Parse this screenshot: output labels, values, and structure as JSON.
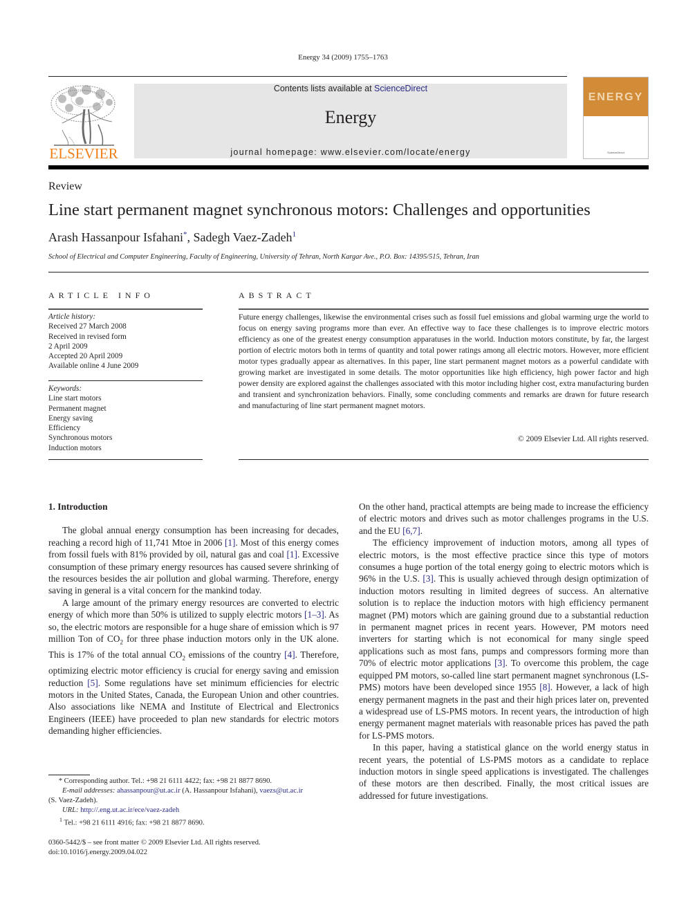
{
  "running_head": "Energy 34 (2009) 1755–1763",
  "masthead": {
    "publisher_logo_text": "ELSEVIER",
    "contents_prefix": "Contents lists available at ",
    "contents_link": "ScienceDirect",
    "journal_name": "Energy",
    "homepage_label": "journal homepage: www.elsevier.com/locate/energy",
    "cover_word": "ENERGY",
    "cover_footer": "ScienceDirect",
    "colors": {
      "elsevier_orange": "#f07f1a",
      "banner_gray": "#e6e6e6",
      "cover_orange": "#d28b36",
      "link_blue": "#2a2a86"
    }
  },
  "article": {
    "type": "Review",
    "title": "Line start permanent magnet synchronous motors: Challenges and opportunities",
    "authors": [
      {
        "name": "Arash Hassanpour Isfahani",
        "mark": "*"
      },
      {
        "name": "Sadegh Vaez-Zadeh",
        "mark": "1"
      }
    ],
    "author_separator": ", ",
    "affiliation": "School of Electrical and Computer Engineering, Faculty of Engineering, University of Tehran, North Kargar Ave., P.O. Box: 14395/515, Tehran, Iran"
  },
  "article_info": {
    "heading": "ARTICLE INFO",
    "history_label": "Article history:",
    "history": [
      "Received 27 March 2008",
      "Received in revised form",
      "2 April 2009",
      "Accepted 20 April 2009",
      "Available online 4 June 2009"
    ],
    "keywords_label": "Keywords:",
    "keywords": [
      "Line start motors",
      "Permanent magnet",
      "Energy saving",
      "Efficiency",
      "Synchronous motors",
      "Induction motors"
    ]
  },
  "abstract": {
    "heading": "ABSTRACT",
    "text": "Future energy challenges, likewise the environmental crises such as fossil fuel emissions and global warming urge the world to focus on energy saving programs more than ever. An effective way to face these challenges is to improve electric motors efficiency as one of the greatest energy consumption apparatuses in the world. Induction motors constitute, by far, the largest portion of electric motors both in terms of quantity and total power ratings among all electric motors. However, more efficient motor types gradually appear as alternatives. In this paper, line start permanent magnet motors as a powerful candidate with growing market are investigated in some details. The motor opportunities like high efficiency, high power factor and high power density are explored against the challenges associated with this motor including higher cost, extra manufacturing burden and transient and synchronization behaviors. Finally, some concluding comments and remarks are drawn for future research and manufacturing of line start permanent magnet motors.",
    "copyright": "© 2009 Elsevier Ltd. All rights reserved."
  },
  "body": {
    "section_heading": "1.  Introduction",
    "left_paragraphs": [
      [
        {
          "t": "The global annual energy consumption has been increasing for decades, reaching a record high of 11,741 Mtoe in 2006 "
        },
        {
          "ref": "[1]"
        },
        {
          "t": ". Most of this energy comes from fossil fuels with 81% provided by oil, natural gas and coal "
        },
        {
          "ref": "[1]"
        },
        {
          "t": ". Excessive consumption of these primary energy resources has caused severe shrinking of the resources besides the air pollution and global warming. Therefore, energy saving in general is a vital concern for the mankind today."
        }
      ],
      [
        {
          "t": "A large amount of the primary energy resources are converted to electric energy of which more than 50% is utilized to supply electric motors "
        },
        {
          "ref": "[1–3]"
        },
        {
          "t": ". As so, the electric motors are responsible for a huge share of emission which is 97 million Ton of CO"
        },
        {
          "sub": "2"
        },
        {
          "t": " for three phase induction motors only in the UK alone. This is 17% of the total annual CO"
        },
        {
          "sub": "2"
        },
        {
          "t": " emissions of the country "
        },
        {
          "ref": "[4]"
        },
        {
          "t": ". Therefore, optimizing electric motor efficiency is crucial for energy saving and emission reduction "
        },
        {
          "ref": "[5]"
        },
        {
          "t": ". Some regulations have set minimum efficiencies for electric motors in the United States, Canada, the European Union and other countries. Also associations like NEMA and Institute of Electrical and Electronics Engineers (IEEE) have proceeded to plan new standards for electric motors demanding higher efficiencies."
        }
      ]
    ],
    "right_paragraphs": [
      [
        {
          "t": "On the other hand, practical attempts are being made to increase the efficiency of electric motors and drives such as motor challenges programs in the U.S. and the EU "
        },
        {
          "ref": "[6,7]"
        },
        {
          "t": "."
        }
      ],
      [
        {
          "t": "The efficiency improvement of induction motors, among all types of electric motors, is the most effective practice since this type of motors consumes a huge portion of the total energy going to electric motors which is 96% in the U.S. "
        },
        {
          "ref": "[3]"
        },
        {
          "t": ". This is usually achieved through design optimization of induction motors resulting in limited degrees of success. An alternative solution is to replace the induction motors with high efficiency permanent magnet (PM) motors which are gaining ground due to a substantial reduction in permanent magnet prices in recent years. However, PM motors need inverters for starting which is not economical for many single speed applications such as most fans, pumps and compressors forming more than 70% of electric motor applications "
        },
        {
          "ref": "[3]"
        },
        {
          "t": ". To overcome this problem, the cage equipped PM motors, so-called line start permanent magnet synchronous (LS-PMS) motors have been developed since 1955 "
        },
        {
          "ref": "[8]"
        },
        {
          "t": ". However, a lack of high energy permanent magnets in the past and their high prices later on, prevented a widespread use of LS-PMS motors. In recent years, the introduction of high energy permanent magnet materials with reasonable prices has paved the path for LS-PMS motors."
        }
      ],
      [
        {
          "t": "In this paper, having a statistical glance on the world energy status in recent years, the potential of LS-PMS motors as a candidate to replace induction motors in single speed applications is investigated. The challenges of these motors are then described. Finally, the most critical issues are addressed for future investigations."
        }
      ]
    ]
  },
  "footnotes": {
    "corresponding_mark": "*",
    "corresponding": "Corresponding author. Tel.: +98 21 6111 4422; fax: +98 21 8877 8690.",
    "email_label": "E-mail addresses: ",
    "email1": "ahassanpour@ut.ac.ir",
    "email1_owner": " (A. Hassanpour Isfahani), ",
    "email2": "vaezs@ut.ac.ir",
    "email2_owner": "(S. Vaez-Zadeh).",
    "url_label": "URL: ",
    "url": "http://.eng.ut.ac.ir/ece/vaez-zadeh",
    "note1_mark": "1",
    "note1": "Tel.: +98 21 6111 4916; fax: +98 21 8877 8690."
  },
  "issn_line": "0360-5442/$ – see front matter © 2009 Elsevier Ltd. All rights reserved.",
  "doi": "doi:10.1016/j.energy.2009.04.022"
}
